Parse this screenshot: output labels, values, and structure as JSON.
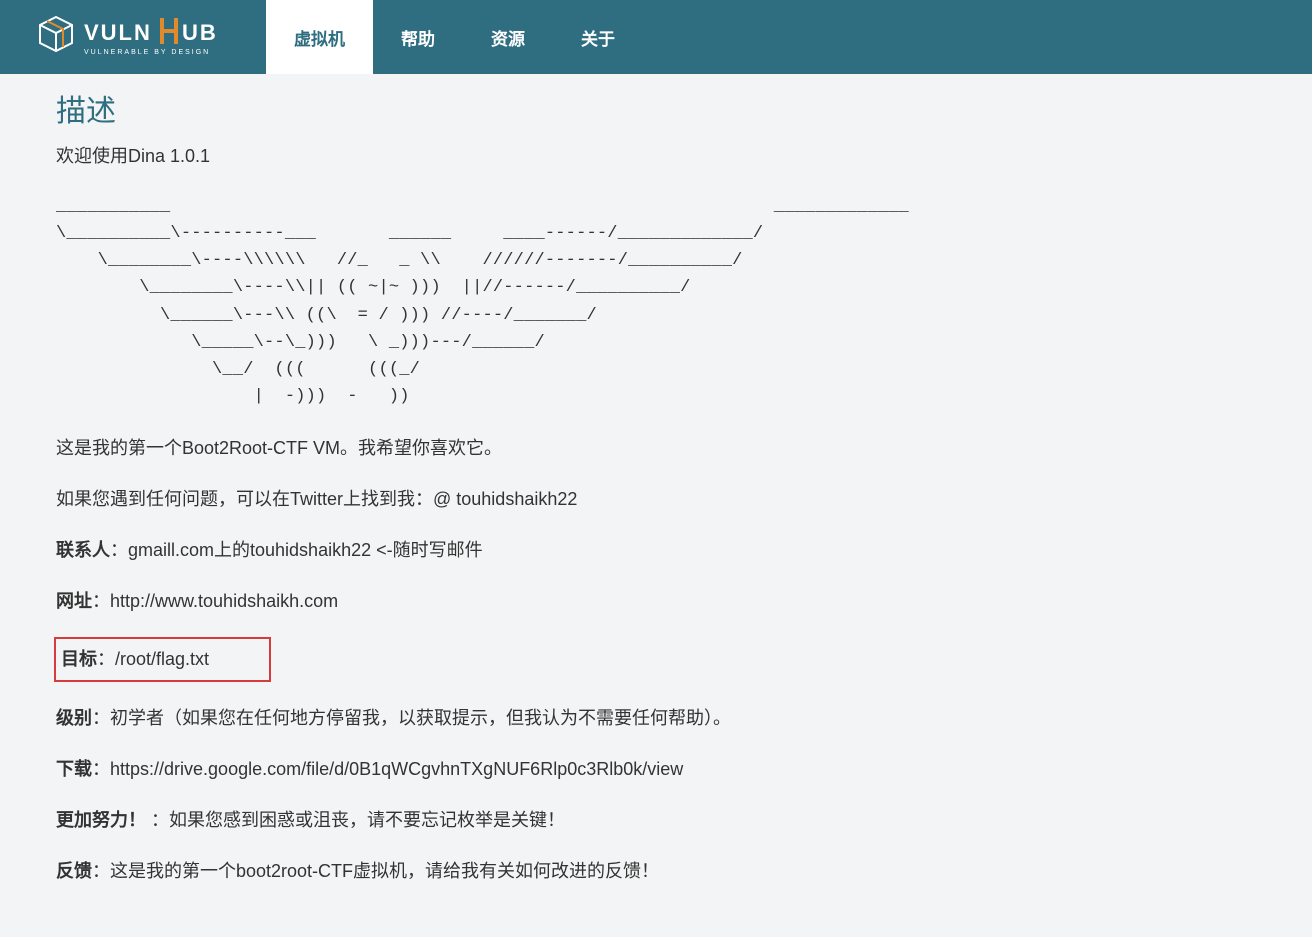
{
  "nav": {
    "items": [
      "虚拟机",
      "帮助",
      "资源",
      "关于"
    ],
    "active_index": 0
  },
  "logo": {
    "main": "VULN",
    "accent": "HUB",
    "tagline": "VULNERABLE BY DESIGN"
  },
  "content": {
    "section_title": "描述",
    "welcome": "欢迎使用Dina 1.0.1",
    "ascii_art": "___________                                                          _____________\n\\__________\\----------___       ______     ____------/_____________/\n    \\________\\----\\\\\\\\\\\\   //_   _ \\\\    //////-------/__________/\n        \\________\\----\\\\|| (( ~|~ )))  ||//------/__________/\n          \\______\\---\\\\ ((\\  = / ))) //----/_______/\n             \\_____\\--\\_)))   \\ _)))---/______/\n               \\__/  (((      (((_/\n                   |  -)))  -   ))",
    "intro1": "这是我的第一个Boot2Root-CTF VM。我希望你喜欢它。",
    "intro2": "如果您遇到任何问题，可以在Twitter上找到我：@ touhidshaikh22",
    "lines": [
      {
        "label": "联系人",
        "value": "：gmaill.com上的touhidshaikh22 <-随时写邮件"
      },
      {
        "label": "网址",
        "value": "：http://www.touhidshaikh.com"
      },
      {
        "label": "目标",
        "value": "：/root/flag.txt",
        "highlight": true
      },
      {
        "label": "级别",
        "value": "：初学者（如果您在任何地方停留我，以获取提示，但我认为不需要任何帮助）。"
      },
      {
        "label": "下载",
        "value": "：https://drive.google.com/file/d/0B1qWCgvhnTXgNUF6Rlp0c3Rlb0k/view"
      },
      {
        "label": "更加努力！",
        "value": " ：如果您感到困惑或沮丧，请不要忘记枚举是关键！"
      },
      {
        "label": "反馈",
        "value": "：这是我的第一个boot2root-CTF虚拟机，请给我有关如何改进的反馈！"
      }
    ]
  }
}
